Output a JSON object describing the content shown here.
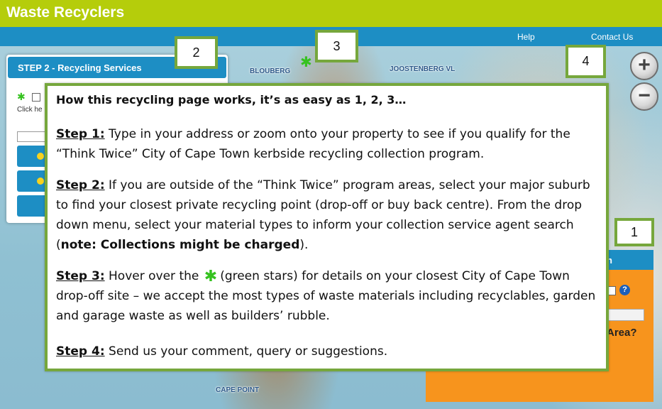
{
  "app": {
    "title": "Waste Recyclers"
  },
  "nav": {
    "help": "Help",
    "contact": "Contact Us"
  },
  "map": {
    "labels": {
      "blouberg": "BLOUBERG",
      "joostenberg": "JOOSTENBERG VL",
      "cape_point": "CAPE POINT"
    },
    "zoom_in": "+",
    "zoom_out": "−"
  },
  "step2_panel": {
    "title": "STEP 2 - Recycling Services",
    "click_text": "Click he"
  },
  "step1_panel": {
    "header_fragment": "n",
    "help_glyph": "?",
    "area_text": "Area?"
  },
  "callouts": {
    "one": "1",
    "two": "2",
    "three": "3",
    "four": "4"
  },
  "info": {
    "title": "How this recycling page works, it’s as easy as 1, 2, 3…",
    "step1_label": "Step 1:",
    "step1_text": " Type in your address or zoom onto your property to see if you qualify for the “Think Twice” City of Cape Town kerbside recycling collection program.",
    "step2_label": "Step 2:",
    "step2_text": " If you are outside of the “Think Twice” program areas, select your major suburb to find your closest private recycling point (drop-off or buy back centre). From the drop down menu, select your material types to inform your collection service agent search (",
    "step2_note": "note: Collections might be charged",
    "step2_end": ").",
    "step3_label": "Step 3:",
    "step3_pre": " Hover over the ",
    "step3_post": "(green stars) for details on your closest City of Cape Town drop-off site – we accept the most types of waste materials including recyclables, garden and garage waste as well as builders’ rubble.",
    "step4_label": "Step 4:",
    "step4_text": " Send us your comment, query or suggestions."
  },
  "colors": {
    "topbar": "#b5cd0b",
    "navbar": "#1d8ec4",
    "callout_border": "#76a73c",
    "orange_panel": "#f7941d",
    "star": "#35c21f"
  },
  "icons": {
    "star": "green-star-icon",
    "zoom_in": "zoom-in-icon",
    "zoom_out": "zoom-out-icon",
    "help": "help-icon"
  }
}
